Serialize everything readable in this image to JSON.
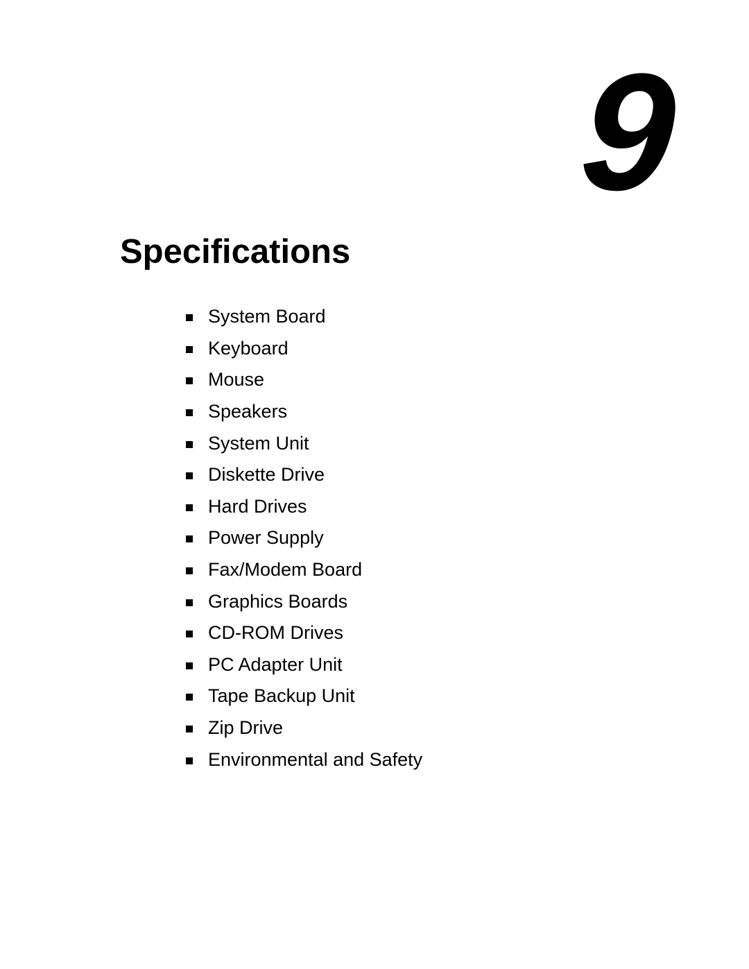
{
  "chapter": {
    "number": "9",
    "title": "Specifications"
  },
  "topics": [
    {
      "label": "System Board",
      "bullet_icon": "square-bullet"
    },
    {
      "label": "Keyboard",
      "bullet_icon": "square-bullet"
    },
    {
      "label": "Mouse",
      "bullet_icon": "square-bullet"
    },
    {
      "label": "Speakers",
      "bullet_icon": "square-bullet"
    },
    {
      "label": "System Unit",
      "bullet_icon": "square-bullet"
    },
    {
      "label": "Diskette Drive",
      "bullet_icon": "square-bullet"
    },
    {
      "label": "Hard Drives",
      "bullet_icon": "square-bullet"
    },
    {
      "label": "Power Supply",
      "bullet_icon": "square-bullet"
    },
    {
      "label": "Fax/Modem Board",
      "bullet_icon": "square-bullet"
    },
    {
      "label": "Graphics Boards",
      "bullet_icon": "square-bullet"
    },
    {
      "label": "CD-ROM Drives",
      "bullet_icon": "square-bullet"
    },
    {
      "label": "PC Adapter Unit",
      "bullet_icon": "square-bullet"
    },
    {
      "label": "Tape Backup Unit",
      "bullet_icon": "square-bullet"
    },
    {
      "label": "Zip Drive",
      "bullet_icon": "square-bullet"
    },
    {
      "label": "Environmental and Safety",
      "bullet_icon": "square-bullet"
    }
  ]
}
